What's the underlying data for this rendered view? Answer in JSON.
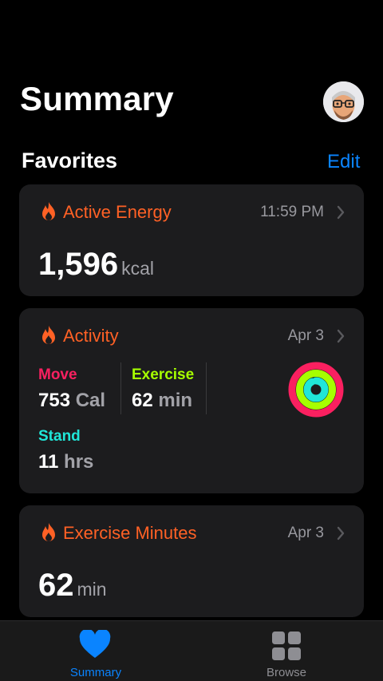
{
  "header": {
    "title": "Summary"
  },
  "favorites": {
    "title": "Favorites",
    "edit_label": "Edit"
  },
  "cards": {
    "active_energy": {
      "title": "Active Energy",
      "time": "11:59 PM",
      "value": "1,596",
      "unit": "kcal"
    },
    "activity": {
      "title": "Activity",
      "date": "Apr 3",
      "move": {
        "label": "Move",
        "value": "753",
        "unit": "Cal",
        "progress": 1.0
      },
      "exercise": {
        "label": "Exercise",
        "value": "62",
        "unit": "min",
        "progress": 1.0
      },
      "stand": {
        "label": "Stand",
        "value": "11",
        "unit": "hrs",
        "progress": 0.92
      }
    },
    "exercise_minutes": {
      "title": "Exercise Minutes",
      "date": "Apr 3",
      "value": "62",
      "unit": "min"
    }
  },
  "tabbar": {
    "summary": {
      "label": "Summary",
      "icon": "heart-icon",
      "selected": true
    },
    "browse": {
      "label": "Browse",
      "icon": "grid-icon",
      "selected": false
    }
  },
  "colors": {
    "accent": "#0a84ff",
    "card_title": "#ff6125",
    "move": "#fa2060",
    "exercise": "#a6ff00",
    "stand": "#20e6d8"
  }
}
